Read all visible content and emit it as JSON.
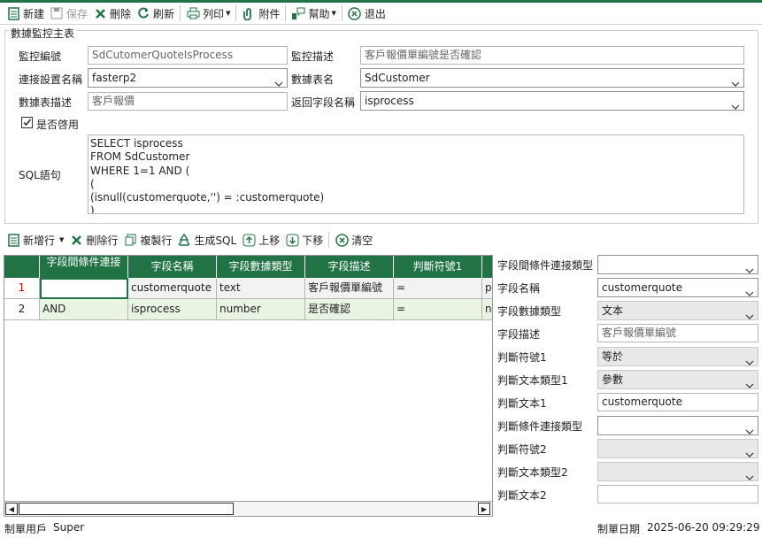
{
  "toolbar": {
    "new": "新建",
    "save": "保存",
    "delete": "刪除",
    "refresh": "刷新",
    "print": "列印",
    "attachment": "附件",
    "help": "幫助",
    "exit": "退出"
  },
  "group": {
    "title": "數據監控主表"
  },
  "form": {
    "monitor_code_label": "監控編號",
    "monitor_code": "SdCutomerQuoteIsProcess",
    "monitor_desc_label": "監控描述",
    "monitor_desc": "客戶報價單編號是否確認",
    "conn_label": "連接設置名稱",
    "conn": "fasterp2",
    "table_label": "數據表名",
    "table": "SdCustomer",
    "table_desc_label": "數據表描述",
    "table_desc": "客戶報價",
    "return_field_label": "返回字段名稱",
    "return_field": "isprocess",
    "enabled_label": "是否啓用",
    "sql_label": "SQL語句",
    "sql": "SELECT isprocess\nFROM SdCustomer\nWHERE 1=1 AND (\n(\n(isnull(customerquote,'') = :customerquote)\n)"
  },
  "toolbar2": {
    "add_row": "新增行",
    "delete_row": "刪除行",
    "copy_row": "複製行",
    "gen_sql": "生成SQL",
    "move_up": "上移",
    "move_down": "下移",
    "clear": "清空"
  },
  "grid": {
    "columns": [
      "字段間條件連接",
      "字段名稱",
      "字段數據類型",
      "字段描述",
      "判斷符號1"
    ],
    "rows": [
      {
        "num": "1",
        "conn": "",
        "field": "customerquote",
        "type": "text",
        "desc": "客戶報價單編號",
        "op": "=",
        "more": "pa"
      },
      {
        "num": "2",
        "conn": "AND",
        "field": "isprocess",
        "type": "number",
        "desc": "是否確認",
        "op": "=",
        "more": "nu"
      }
    ]
  },
  "props": {
    "conn_type_label": "字段間條件連接類型",
    "conn_type": "",
    "field_name_label": "字段名稱",
    "field_name": "customerquote",
    "field_type_label": "字段數據類型",
    "field_type": "文本",
    "field_desc_label": "字段描述",
    "field_desc": "客戶報價單編號",
    "op1_label": "判斷符號1",
    "op1": "等於",
    "text_type1_label": "判斷文本類型1",
    "text_type1": "參數",
    "text1_label": "判斷文本1",
    "text1": "customerquote",
    "cond_conn_label": "判斷條件連接類型",
    "cond_conn": "",
    "op2_label": "判斷符號2",
    "op2": "",
    "text_type2_label": "判斷文本類型2",
    "text_type2": "",
    "text2_label": "判斷文本2",
    "text2": ""
  },
  "status": {
    "user_label": "制單用戶",
    "user": "Super",
    "date_label": "制單日期",
    "date": "2025-06-20 09:29:29"
  },
  "colors": {
    "accent": "#217346",
    "row_alt": "#e8f5e3",
    "row_num_red": "#d00000"
  }
}
